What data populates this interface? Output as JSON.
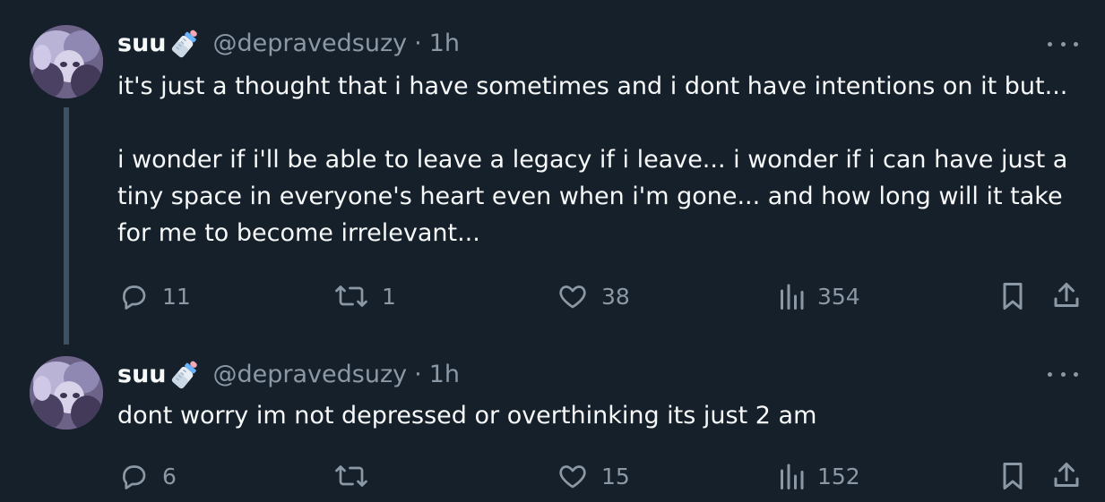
{
  "tweets": [
    {
      "display_name": "suu",
      "name_emoji": "baby-bottle-icon",
      "handle": "@depravedsuzy",
      "separator": "·",
      "time": "1h",
      "paragraphs": [
        "it's just a thought that i have sometimes and i dont have intentions on it but...",
        "i wonder if i'll be able to leave a legacy if i leave... i wonder if i can have just a tiny space in everyone's heart even when i'm gone... and how long will it take for me to become irrelevant..."
      ],
      "replies": "11",
      "retweets": "1",
      "likes": "38",
      "views": "354"
    },
    {
      "display_name": "suu",
      "name_emoji": "baby-bottle-icon",
      "handle": "@depravedsuzy",
      "separator": "·",
      "time": "1h",
      "paragraphs": [
        "dont worry im not depressed or overthinking its just 2 am"
      ],
      "replies": "6",
      "retweets": "",
      "likes": "15",
      "views": "152"
    }
  ],
  "colors": {
    "background": "#15202b",
    "text_primary": "#f7f9f9",
    "text_secondary": "#8b98a5",
    "thread_line": "#3e5163"
  }
}
